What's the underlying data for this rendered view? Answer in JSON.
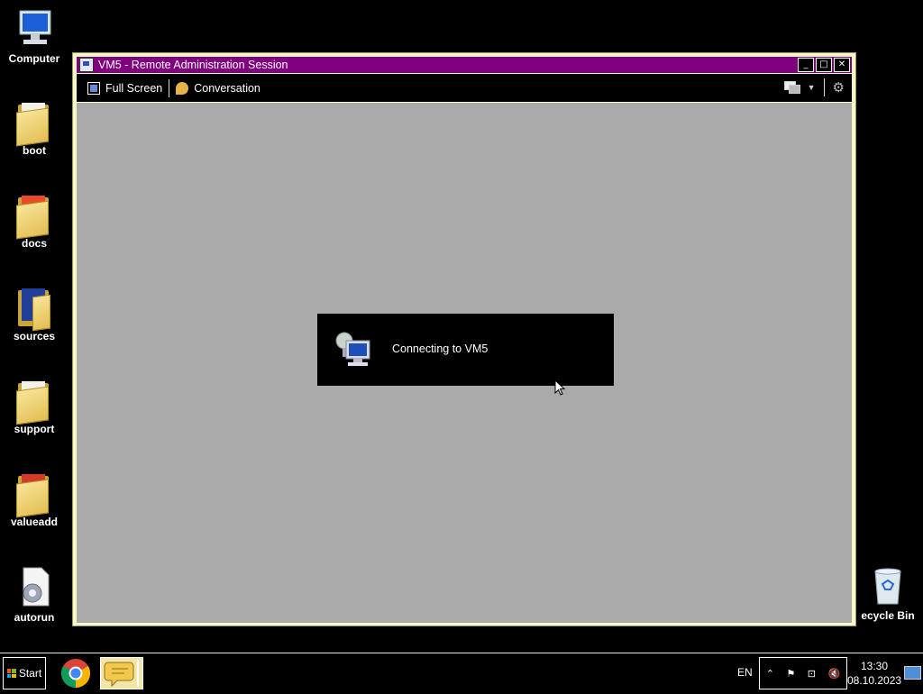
{
  "desktop": {
    "icons": [
      {
        "label": "Computer",
        "icon": "computer-icon"
      },
      {
        "label": "boot",
        "icon": "folder-icon"
      },
      {
        "label": "docs",
        "icon": "folder-icon"
      },
      {
        "label": "sources",
        "icon": "folder-icon"
      },
      {
        "label": "support",
        "icon": "folder-icon"
      },
      {
        "label": "valueadd",
        "icon": "folder-icon"
      },
      {
        "label": "autorun",
        "icon": "autorun-icon"
      }
    ],
    "recycle_bin": {
      "label": "ecycle Bin",
      "icon": "recycle-bin-icon"
    }
  },
  "window": {
    "title": "VM5 - Remote Administration Session",
    "title_color": "#80007f",
    "controls": {
      "minimize": "minimize-icon",
      "maximize": "maximize-icon",
      "close": "close-icon"
    },
    "toolbar": {
      "full_screen_label": "Full Screen",
      "conversation_label": "Conversation"
    },
    "status": {
      "text": "Connecting to VM5"
    }
  },
  "taskbar": {
    "start_label": "Start",
    "language": "EN",
    "clock_time": "13:30",
    "clock_date": "08.10.2023"
  }
}
